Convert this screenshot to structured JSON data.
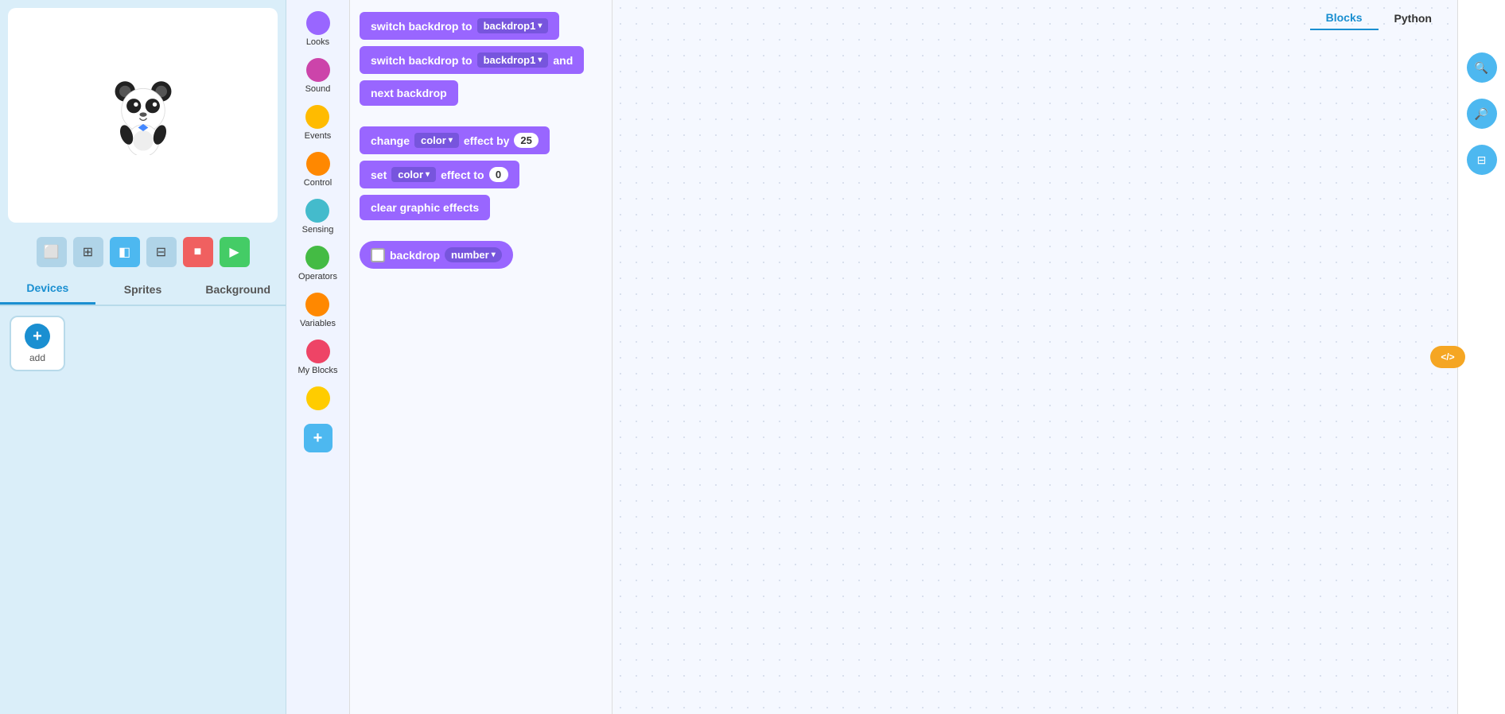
{
  "left": {
    "tabs": [
      {
        "id": "devices",
        "label": "Devices",
        "active": true
      },
      {
        "id": "sprites",
        "label": "Sprites",
        "active": false
      },
      {
        "id": "background",
        "label": "Background",
        "active": false
      }
    ],
    "add_label": "add"
  },
  "categories": [
    {
      "id": "looks",
      "label": "Looks",
      "color": "#9966ff"
    },
    {
      "id": "sound",
      "label": "Sound",
      "color": "#cc44aa"
    },
    {
      "id": "events",
      "label": "Events",
      "color": "#ffbb00"
    },
    {
      "id": "control",
      "label": "Control",
      "color": "#ff8800"
    },
    {
      "id": "sensing",
      "label": "Sensing",
      "color": "#44bbcc"
    },
    {
      "id": "operators",
      "label": "Operators",
      "color": "#44bb44"
    },
    {
      "id": "variables",
      "label": "Variables",
      "color": "#ff8800"
    },
    {
      "id": "my_blocks",
      "label": "My Blocks",
      "color": "#ee4466"
    },
    {
      "id": "extra",
      "label": "",
      "color": "#ffcc00"
    }
  ],
  "blocks": [
    {
      "id": "switch-backdrop-1",
      "type": "command",
      "text_before": "switch backdrop to",
      "dropdown": "backdrop1",
      "text_after": ""
    },
    {
      "id": "switch-backdrop-2",
      "type": "command",
      "text_before": "switch backdrop to",
      "dropdown": "backdrop1",
      "text_after": "and"
    },
    {
      "id": "next-backdrop",
      "type": "command",
      "text": "next backdrop"
    },
    {
      "id": "change-color-effect",
      "type": "command",
      "text_before": "change",
      "dropdown": "color",
      "text_middle": "effect by",
      "input": "25"
    },
    {
      "id": "set-color-effect",
      "type": "command",
      "text_before": "set",
      "dropdown": "color",
      "text_middle": "effect to",
      "input": "0"
    },
    {
      "id": "clear-graphic-effects",
      "type": "command",
      "text": "clear graphic effects"
    },
    {
      "id": "backdrop-number",
      "type": "reporter",
      "text_before": "backdrop",
      "dropdown": "number",
      "has_checkbox": true
    }
  ],
  "toolbar": {
    "blocks_label": "Blocks",
    "python_label": "Python",
    "code_icon": "</>"
  },
  "right_buttons": [
    {
      "id": "zoom-in",
      "icon": "🔍"
    },
    {
      "id": "zoom-out",
      "icon": "🔎"
    },
    {
      "id": "fit",
      "icon": "⊟"
    }
  ]
}
